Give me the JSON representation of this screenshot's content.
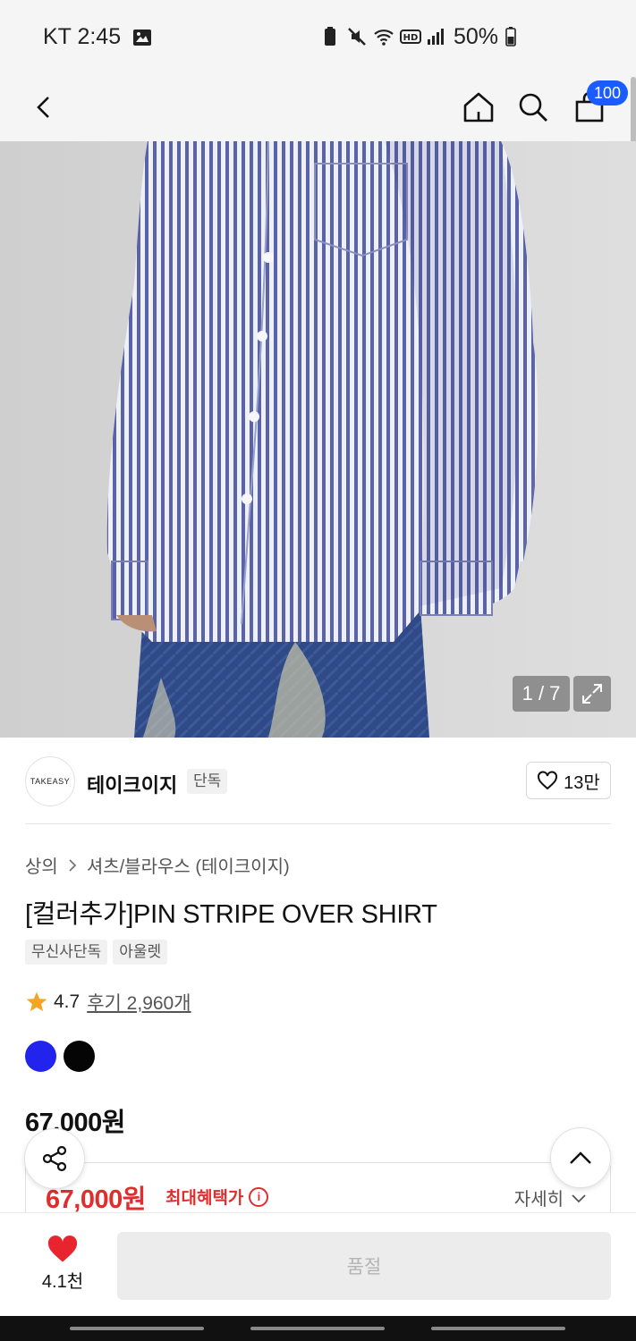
{
  "status_bar": {
    "carrier_time": "KT 2:45",
    "battery": "50%"
  },
  "nav": {
    "cart_count": "100"
  },
  "gallery": {
    "pager": "1 / 7"
  },
  "brand": {
    "logo_text": "TAKEASY",
    "name": "테이크이지",
    "tag": "단독",
    "likes": "13만"
  },
  "breadcrumb": {
    "category": "상의",
    "subcategory": "셔츠/블라우스 (테이크이지)"
  },
  "product": {
    "title": "[컬러추가]PIN STRIPE OVER SHIRT",
    "tags": [
      "무신사단독",
      "아울렛"
    ],
    "rating": "4.7",
    "reviews": "후기 2,960개",
    "colors": [
      "#2323ee",
      "#050505"
    ],
    "price": "67,000원"
  },
  "benefit": {
    "price": "67,000원",
    "label": "최대혜택가",
    "detail": "자세히"
  },
  "bottom": {
    "like_count": "4.1천",
    "buy_label": "품절"
  },
  "colors": {
    "accent_red": "#e02d2d",
    "badge_blue": "#1a5cff"
  }
}
